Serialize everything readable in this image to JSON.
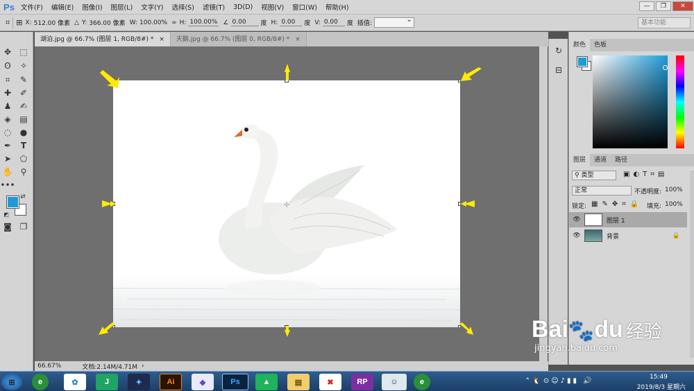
{
  "app": {
    "logo": "Ps",
    "menu": [
      "文件(F)",
      "编辑(E)",
      "图像(I)",
      "图层(L)",
      "文字(Y)",
      "选择(S)",
      "滤镜(T)",
      "3D(D)",
      "视图(V)",
      "窗口(W)",
      "帮助(H)"
    ]
  },
  "options": {
    "x_label": "X:",
    "x_value": "512.00 像素",
    "y_label": "Y:",
    "y_value": "366.00 像素",
    "w_label": "W:",
    "w_value": "100.00%",
    "h_label": "H:",
    "h_value": "100.00%",
    "angle_value": "0.00",
    "angle_unit": "度",
    "hskew_label": "H:",
    "hskew_value": "0.00",
    "hskew_unit": "度",
    "vskew_label": "V:",
    "vskew_value": "0.00",
    "vskew_unit": "度",
    "interp_label": "插值:",
    "workspace": "基本功能"
  },
  "tabs": [
    {
      "label": "湖泊.jpg @ 66.7% (图层 1, RGB/8#) *",
      "close": "×"
    },
    {
      "label": "天鹅.jpg @ 66.7% (图层 0, RGB/8#) *",
      "close": "×"
    }
  ],
  "status": {
    "zoom": "66.67%",
    "doc": "文档:2.14M/4.71M"
  },
  "panels": {
    "color_tabs": [
      "颜色",
      "色板"
    ],
    "layer_tabs": [
      "图层",
      "通道",
      "路径"
    ],
    "filter_kind": "类型",
    "blend_mode": "正常",
    "opacity_label": "不透明度:",
    "opacity_value": "100%",
    "lock_label": "锁定:",
    "fill_label": "填充:",
    "fill_value": "100%",
    "layers": [
      {
        "name": "图层 1",
        "selected": true
      },
      {
        "name": "背景",
        "selected": false
      }
    ]
  },
  "taskbar": {
    "time": "15:49",
    "date": "2019/8/3 星期六"
  },
  "watermark": {
    "brand": "Bai",
    "brand2": "du",
    "cn": "经验",
    "url": "jingyan.baidu.com"
  },
  "colors": {
    "foreground": "#1e9bd7",
    "background": "#ffffff",
    "arrow": "#ffeb00"
  }
}
